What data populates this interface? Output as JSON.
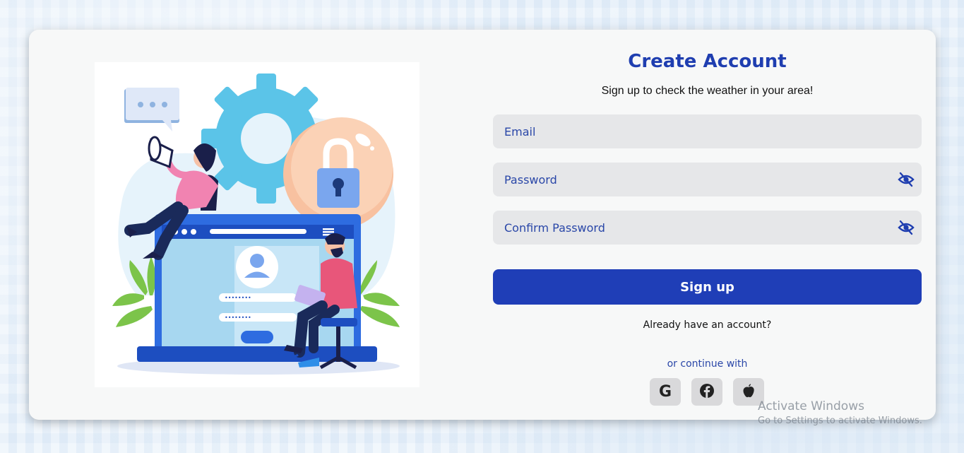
{
  "form": {
    "title": "Create Account",
    "subtitle": "Sign up to check the weather in your area!",
    "email_placeholder": "Email",
    "password_placeholder": "Password",
    "confirm_placeholder": "Confirm Password",
    "signup_label": "Sign up",
    "already_account": "Already have an account?",
    "continue_with": "or continue with"
  },
  "social": {
    "google_letter": "G",
    "icons": [
      "google-icon",
      "facebook-icon",
      "apple-icon"
    ]
  },
  "watermark": {
    "line1": "Activate Windows",
    "line2": "Go to Settings to activate Windows."
  },
  "colors": {
    "accent": "#1f3eb7",
    "title": "#1f3eb0",
    "field_bg": "#e6e7e9",
    "card_bg": "#f7f8f8"
  }
}
